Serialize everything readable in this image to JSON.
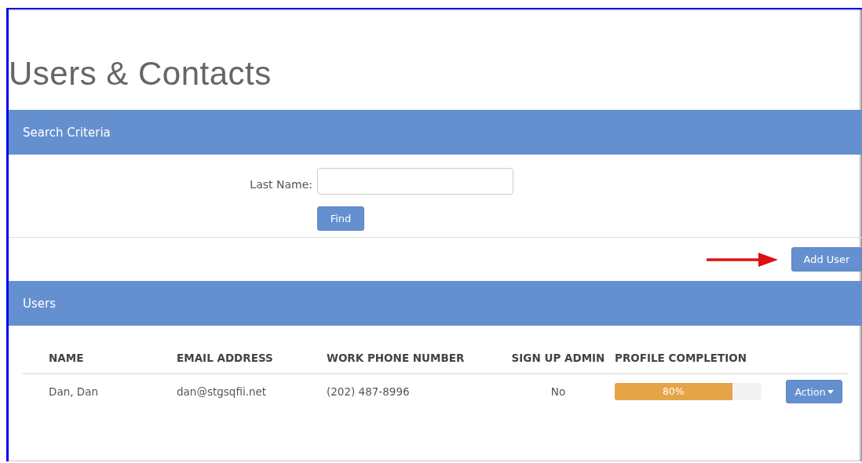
{
  "page": {
    "title": "Users & Contacts"
  },
  "search": {
    "header": "Search Criteria",
    "field_label": "Last Name:",
    "find_button": "Find"
  },
  "add_user_button": "Add User",
  "users": {
    "header": "Users",
    "columns": [
      "NAME",
      "EMAIL ADDRESS",
      "WORK PHONE NUMBER",
      "SIGN UP ADMIN",
      "PROFILE COMPLETION"
    ],
    "rows": [
      {
        "name": "Dan, Dan",
        "email": "dan@stgsqfii.net",
        "phone": "(202) 487-8996",
        "admin": "No",
        "completion": "80%",
        "level": 0.8,
        "action": "Action"
      }
    ]
  }
}
